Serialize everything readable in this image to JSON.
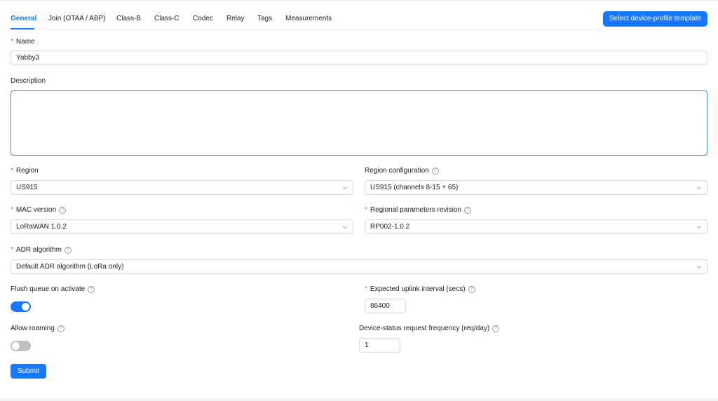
{
  "tabs": [
    {
      "label": "General"
    },
    {
      "label": "Join (OTAA / ABP)"
    },
    {
      "label": "Class-B"
    },
    {
      "label": "Class-C"
    },
    {
      "label": "Codec"
    },
    {
      "label": "Relay"
    },
    {
      "label": "Tags"
    },
    {
      "label": "Measurements"
    }
  ],
  "active_tab": "General",
  "template_button": "Select device-profile template",
  "form": {
    "name": {
      "label": "Name",
      "value": "Yabby3",
      "required": true
    },
    "description": {
      "label": "Description",
      "value": ""
    },
    "region": {
      "label": "Region",
      "value": "US915",
      "required": true
    },
    "region_config": {
      "label": "Region configuration",
      "value": "US915 (channels 8-15 + 65)"
    },
    "mac_version": {
      "label": "MAC version",
      "value": "LoRaWAN 1.0.2",
      "required": true
    },
    "regional_params": {
      "label": "Regional parameters revision",
      "value": "RP002-1.0.2",
      "required": true
    },
    "adr": {
      "label": "ADR algorithm",
      "value": "Default ADR algorithm (LoRa only)",
      "required": true
    },
    "flush_queue": {
      "label": "Flush queue on activate",
      "checked": true
    },
    "uplink_interval": {
      "label": "Expected uplink interval (secs)",
      "value": "86400",
      "required": true
    },
    "allow_roaming": {
      "label": "Allow roaming",
      "checked": false
    },
    "status_freq": {
      "label": "Device-status request frequency (req/day)",
      "value": "1"
    }
  },
  "submit_label": "Submit",
  "help_glyph": "?",
  "required_glyph": "*",
  "colors": {
    "primary": "#1677ff",
    "required": "#ff4d4f",
    "border": "#d9d9d9",
    "switch_off": "#bfbfbf"
  }
}
